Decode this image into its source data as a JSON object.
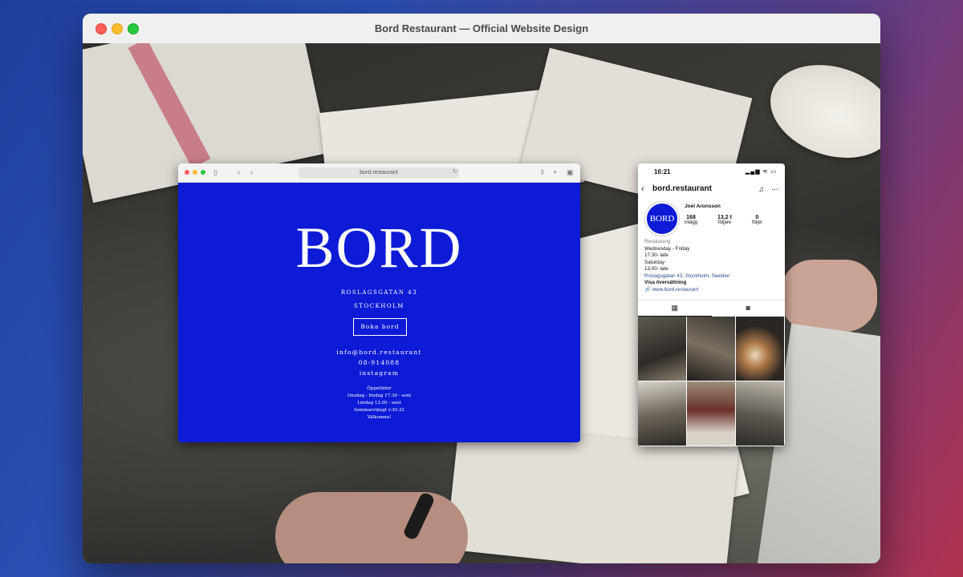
{
  "window": {
    "title": "Bord Restaurant — Official Website Design"
  },
  "browser": {
    "url": "bord.restaurant",
    "logo": "BORD",
    "address_line1": "ROSLAGSGATAN 43",
    "address_line2": "STOCKHOLM",
    "book_button": "Boka bord",
    "email": "info@bord.restaurant",
    "phone": "08-914088",
    "instagram_link": "instagram",
    "hours": {
      "title": "Öppettider",
      "line1": "Onsdag - fredag 17.30 - sent",
      "line2": "Lördag 13.00 - sent",
      "line3": "Sommarstängt v.30-32",
      "line4": "Välkomna!"
    }
  },
  "phone": {
    "time": "16:21",
    "status_icons": "▂▄▆ ≋ ▭",
    "username": "bord.restaurant",
    "avatar_text": "BORD",
    "display_name": "Joel Aronsson",
    "stats": [
      {
        "value": "168",
        "label": "inlägg"
      },
      {
        "value": "13,2 t",
        "label": "följare"
      },
      {
        "value": "0",
        "label": "följer"
      }
    ],
    "bio": {
      "category": "Restaurang",
      "line1": "Wednesday - Friday",
      "line2": "17.30- late",
      "line3": "Saturday",
      "line4": "13.00- late",
      "location": "Roslagsgatan 43, Stockholm, Sweden",
      "translate": "Visa översättning",
      "website": "www.bord.restaurant"
    }
  },
  "colors": {
    "brand_blue": "#0d1bd6"
  }
}
